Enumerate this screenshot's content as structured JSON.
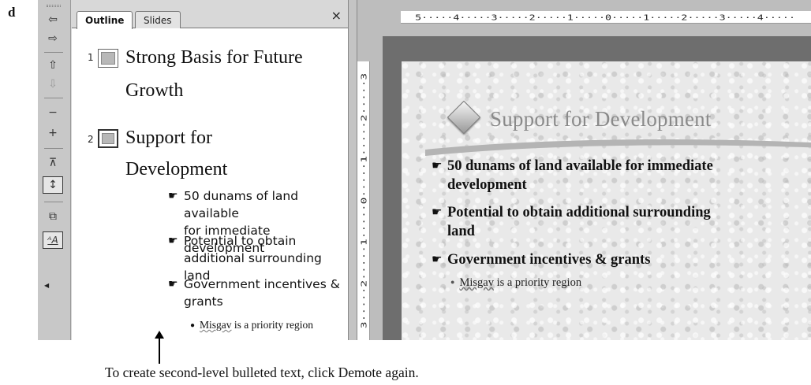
{
  "panel_label": "d",
  "toolbar": {
    "buttons": [
      {
        "name": "promote-icon",
        "glyph": "⇦"
      },
      {
        "name": "demote-icon",
        "glyph": "⇨"
      },
      {
        "name": "move-up-icon",
        "glyph": "⇧"
      },
      {
        "name": "move-down-icon",
        "glyph": "⇩"
      },
      {
        "name": "collapse-icon",
        "glyph": "−"
      },
      {
        "name": "expand-icon",
        "glyph": "+"
      },
      {
        "name": "collapse-all-icon",
        "glyph": "⊼"
      },
      {
        "name": "expand-all-icon",
        "glyph": "↕"
      },
      {
        "name": "summary-slide-icon",
        "glyph": "⧉"
      },
      {
        "name": "show-formatting-icon",
        "glyph": "ᴬA"
      }
    ]
  },
  "tabs": {
    "outline": "Outline",
    "slides": "Slides",
    "close": "×"
  },
  "outline": {
    "slide1": {
      "number": "1",
      "title_line1": "Strong Basis for Future",
      "title_line2": "Growth"
    },
    "slide2": {
      "number": "2",
      "title_line1": "Support for",
      "title_line2": "Development"
    },
    "bullet_glyph": "☛",
    "bullets": [
      {
        "line1": "50 dunams of land available",
        "line2": "for immediate development"
      },
      {
        "line1": "Potential to obtain",
        "line2": "additional surrounding land"
      },
      {
        "line1": "Government incentives &",
        "line2": "grants"
      }
    ],
    "sub_bullet": {
      "word1": "Misgav",
      "rest": " is a priority region"
    }
  },
  "ruler": {
    "horizontal": "5·····4·····3·····2·····1·····0·····1·····2·····3·····4·····",
    "vertical": "3·····2·····1·····0·····1·····2·····3"
  },
  "slide": {
    "title": "Support for Development",
    "bullets": [
      {
        "line1": "50 dunams of land available for immediate",
        "line2": "development"
      },
      {
        "line1": "Potential to obtain additional surrounding",
        "line2": "land"
      },
      {
        "line1": "Government incentives & grants",
        "line2": ""
      }
    ],
    "sub_bullet": {
      "word1": "Misgav",
      "rest": " is a priority region"
    }
  },
  "caption": "To create second-level bulleted text, click Demote again."
}
